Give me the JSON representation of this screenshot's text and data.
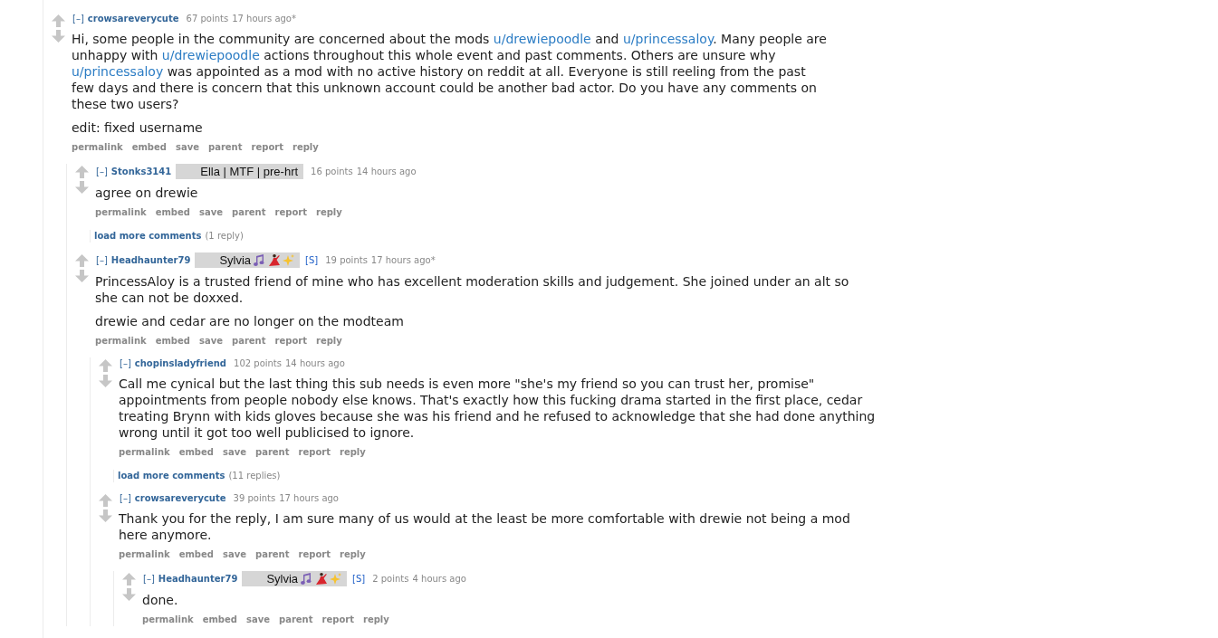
{
  "comments": [
    {
      "kind": "comment",
      "toggle": "[–]",
      "author": "crowsareverycute",
      "score": "67 points",
      "time": "17 hours ago*",
      "body": [
        {
          "parts": [
            {
              "kind": "text",
              "text": "Hi, some people in the community are concerned about the mods "
            },
            {
              "kind": "link",
              "text": "u/drewiepoodle"
            },
            {
              "kind": "text",
              "text": " and "
            },
            {
              "kind": "link",
              "text": "u/princessaloy"
            },
            {
              "kind": "text",
              "text": ". Many people are unhappy with "
            },
            {
              "kind": "link",
              "text": "u/drewiepoodle"
            },
            {
              "kind": "text",
              "text": " actions throughout this whole event and past comments. Others are unsure why "
            },
            {
              "kind": "link",
              "text": "u/princessaloy"
            },
            {
              "kind": "text",
              "text": " was appointed as a mod with no active history on reddit at all. Everyone is still reeling from the past few days and there is concern that this unknown account could be another bad actor. Do you have any comments on these two users?"
            }
          ]
        },
        {
          "parts": [
            {
              "kind": "text",
              "text": "edit: fixed username"
            }
          ]
        }
      ],
      "actions": [
        "permalink",
        "embed",
        "save",
        "parent",
        "report",
        "reply"
      ],
      "children": [
        {
          "kind": "comment",
          "toggle": "[–]",
          "author": "Stonks3141",
          "flair": {
            "text": "Ella | MTF | pre-hrt",
            "emoji": false
          },
          "score": "16 points",
          "time": "14 hours ago",
          "body": [
            {
              "parts": [
                {
                  "kind": "text",
                  "text": "agree on drewie"
                }
              ]
            }
          ],
          "actions": [
            "permalink",
            "embed",
            "save",
            "parent",
            "report",
            "reply"
          ],
          "children": [
            {
              "kind": "load_more",
              "label": "load more comments",
              "count": "(1 reply)"
            }
          ]
        },
        {
          "kind": "comment",
          "toggle": "[–]",
          "author": "Headhaunter79",
          "flair": {
            "text": "Sylvia",
            "emoji": true
          },
          "submitter_tag": "[S]",
          "score": "19 points",
          "time": "17 hours ago*",
          "body": [
            {
              "parts": [
                {
                  "kind": "text",
                  "text": "PrincessAloy is a trusted friend of mine who has excellent moderation skills and judgement. She joined under an alt so she can not be doxxed."
                }
              ]
            },
            {
              "parts": [
                {
                  "kind": "text",
                  "text": "drewie and cedar are no longer on the modteam"
                }
              ]
            }
          ],
          "actions": [
            "permalink",
            "embed",
            "save",
            "parent",
            "report",
            "reply"
          ],
          "children": [
            {
              "kind": "comment",
              "toggle": "[–]",
              "author": "chopinsladyfriend",
              "score": "102 points",
              "time": "14 hours ago",
              "body": [
                {
                  "parts": [
                    {
                      "kind": "text",
                      "text": "Call me cynical but the last thing this sub needs is even more \"she's my friend so you can trust her, promise\" appointments from people nobody else knows. That's exactly how this fucking drama started in the first place, cedar treating Brynn with kids gloves because she was his friend and he refused to acknowledge that she had done anything wrong until it got too well publicised to ignore."
                    }
                  ]
                }
              ],
              "actions": [
                "permalink",
                "embed",
                "save",
                "parent",
                "report",
                "reply"
              ],
              "children": [
                {
                  "kind": "load_more",
                  "label": "load more comments",
                  "count": "(11 replies)"
                }
              ]
            },
            {
              "kind": "comment",
              "toggle": "[–]",
              "author": "crowsareverycute",
              "score": "39 points",
              "time": "17 hours ago",
              "body": [
                {
                  "parts": [
                    {
                      "kind": "text",
                      "text": "Thank you for the reply, I am sure many of us would at the least be more comfortable with drewie not being a mod here anymore."
                    }
                  ]
                }
              ],
              "actions": [
                "permalink",
                "embed",
                "save",
                "parent",
                "report",
                "reply"
              ],
              "children": [
                {
                  "kind": "comment",
                  "toggle": "[–]",
                  "author": "Headhaunter79",
                  "flair": {
                    "text": "Sylvia",
                    "emoji": true
                  },
                  "submitter_tag": "[S]",
                  "score": "2 points",
                  "time": "4 hours ago",
                  "body": [
                    {
                      "parts": [
                        {
                          "kind": "text",
                          "text": "done."
                        }
                      ]
                    }
                  ],
                  "actions": [
                    "permalink",
                    "embed",
                    "save",
                    "parent",
                    "report",
                    "reply"
                  ]
                }
              ]
            }
          ]
        }
      ]
    }
  ]
}
